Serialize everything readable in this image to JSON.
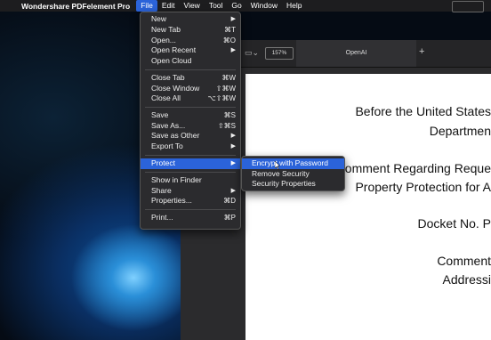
{
  "menubar": {
    "app_name": "Wondershare PDFelement Pro",
    "menus": [
      "File",
      "Edit",
      "View",
      "Tool",
      "Go",
      "Window",
      "Help"
    ]
  },
  "toolbar": {
    "zoom": "157%",
    "tab_label": "OpenAI",
    "add_tab": "+"
  },
  "file_menu": {
    "items": [
      {
        "label": "New",
        "shortcut": "▶"
      },
      {
        "label": "New Tab",
        "shortcut": "⌘T"
      },
      {
        "label": "Open...",
        "shortcut": "⌘O"
      },
      {
        "label": "Open Recent",
        "shortcut": "▶"
      },
      {
        "label": "Open Cloud",
        "shortcut": ""
      },
      {
        "label": "Close Tab",
        "shortcut": "⌘W"
      },
      {
        "label": "Close Window",
        "shortcut": "⇧⌘W"
      },
      {
        "label": "Close All",
        "shortcut": "⌥⇧⌘W"
      },
      {
        "label": "Save",
        "shortcut": "⌘S"
      },
      {
        "label": "Save As...",
        "shortcut": "⇧⌘S"
      },
      {
        "label": "Save as Other",
        "shortcut": "▶"
      },
      {
        "label": "Export To",
        "shortcut": "▶"
      },
      {
        "label": "Protect",
        "shortcut": "▶"
      },
      {
        "label": "Show in Finder",
        "shortcut": ""
      },
      {
        "label": "Share",
        "shortcut": "▶"
      },
      {
        "label": "Properties...",
        "shortcut": "⌘D"
      },
      {
        "label": "Print...",
        "shortcut": "⌘P"
      }
    ]
  },
  "protect_submenu": {
    "items": [
      "Encrypt with Password",
      "Remove Security",
      "Security Properties"
    ]
  },
  "document": {
    "lines": [
      "Before the United States",
      "Departmen",
      "Comment Regarding Reque",
      "Property Protection for A",
      "Docket No. P",
      "Comment",
      "Addressi"
    ]
  }
}
